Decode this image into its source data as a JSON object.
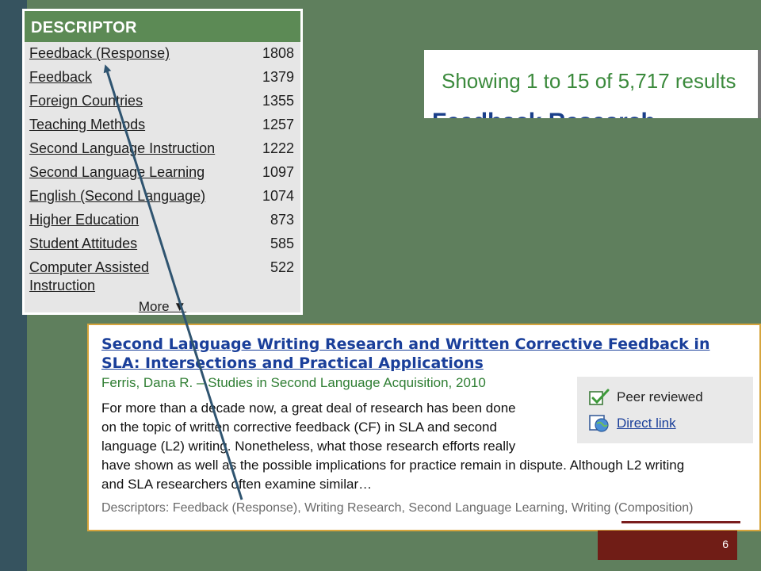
{
  "descriptor_panel": {
    "header": "DESCRIPTOR",
    "items": [
      {
        "label": "Feedback (Response)",
        "count": "1808"
      },
      {
        "label": "Feedback",
        "count": "1379"
      },
      {
        "label": "Foreign Countries",
        "count": "1355"
      },
      {
        "label": "Teaching Methods",
        "count": "1257"
      },
      {
        "label": "Second Language Instruction",
        "count": "1222"
      },
      {
        "label": "Second Language Learning",
        "count": "1097"
      },
      {
        "label": "English (Second Language)",
        "count": "1074"
      },
      {
        "label": "Higher Education",
        "count": "873"
      },
      {
        "label": "Student Attitudes",
        "count": "585"
      },
      {
        "label": "Computer Assisted Instruction",
        "count": "522"
      }
    ],
    "more_label": "More ▼"
  },
  "results": {
    "count_text": "Showing 1 to 15 of 5,717 results",
    "next_title_fragment": "Feedback Research"
  },
  "record": {
    "title": "Second Language Writing Research and Written Corrective Feedback in SLA: Intersections and Practical Applications",
    "author_line": "Ferris, Dana R. – Studies in Second Language Acquisition, 2010",
    "abstract_lines": [
      "For more than a decade now, a great deal of research has been done",
      "on the topic of written corrective feedback (CF) in SLA and second",
      "language (L2) writing. Nonetheless, what those research efforts really",
      "have shown as well as the possible implications for practice remain in dispute. Although L2 writing",
      "and SLA researchers often examine similar…"
    ],
    "descriptors_line": "Descriptors: Feedback (Response), Writing Research, Second Language Learning, Writing (Composition)",
    "peer_reviewed_label": "Peer reviewed",
    "direct_link_label": "Direct link"
  },
  "slide": {
    "page_number": "6"
  },
  "colors": {
    "background": "#5f7f5d",
    "left_bar": "#36535f",
    "descriptor_header": "#5c8a55",
    "link_blue": "#1a3f9a",
    "author_green": "#2f7e33",
    "page_box": "#701d16"
  }
}
